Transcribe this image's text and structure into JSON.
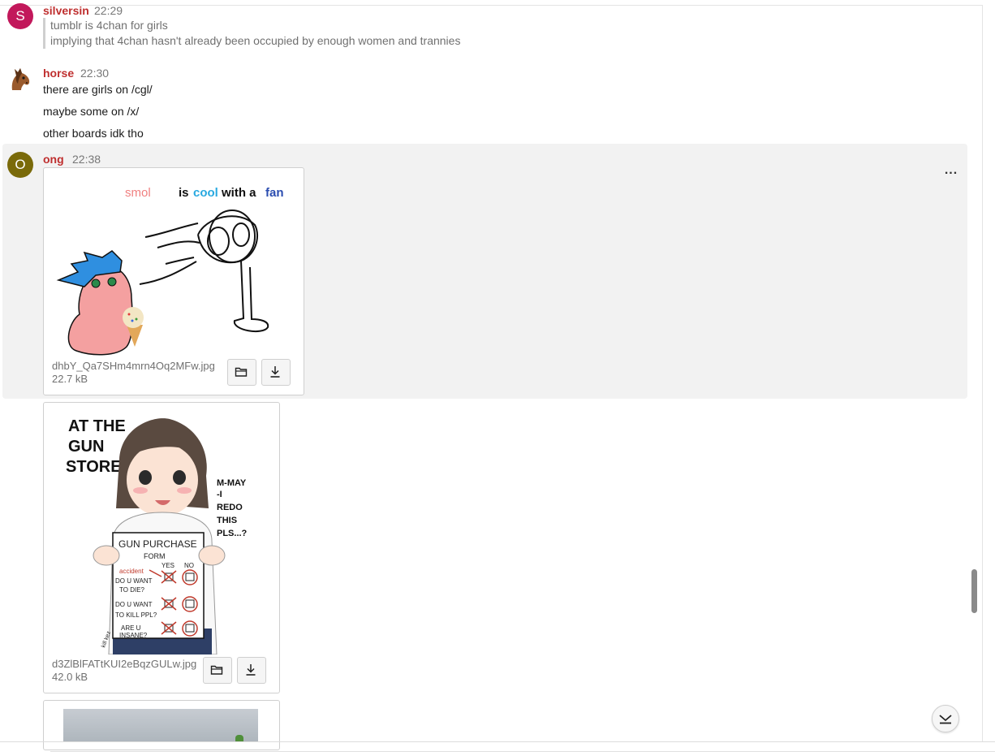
{
  "messages": [
    {
      "sender": "silversin",
      "time": "22:29",
      "avatar_letter": "S",
      "avatar_color": "#c2185b",
      "quote_lines": [
        "tumblr is 4chan for girls",
        "implying that 4chan hasn't already been occupied by enough women and trannies"
      ]
    },
    {
      "sender": "horse",
      "time": "22:30",
      "avatar_icon": "horse-icon",
      "lines": [
        "there are girls on /cgl/",
        "maybe some on /x/",
        "other boards idk tho"
      ]
    },
    {
      "sender": "ong",
      "time": "22:38",
      "avatar_letter": "O",
      "avatar_color": "#7a6a0a",
      "more_label": "...",
      "attachments": [
        {
          "filename": "dhbY_Qa7SHm4mrn4Oq2MFw.jpg",
          "size": "22.7 kB",
          "image_text": {
            "w1": "smol",
            "w2": "is",
            "w3": "cool",
            "w4": "with a",
            "w5": "fan"
          }
        },
        {
          "filename": "d3ZlBlFATtKUI2eBqzGULw.jpg",
          "size": "42.0 kB",
          "image_text": {
            "header": [
              "AT THE",
              "GUN",
              "STORE"
            ],
            "speech": [
              "M-MAY",
              "-I",
              "REDO",
              "THIS",
              "PLS...?"
            ],
            "form_title": "GUN PURCHASE",
            "form_sub": "FORM",
            "accident": "accident",
            "yes": "YES",
            "no": "NO",
            "q1a": "DO U WANT",
            "q1b": "TO DIE?",
            "q2a": "DO U WANT",
            "q2b": "TO KILL PPL?",
            "q3a": "ARE U",
            "q3b": "INSANE?",
            "signature": "kill kez"
          }
        },
        {}
      ]
    }
  ],
  "icons": {
    "open_folder": "folder-icon",
    "download": "download-icon",
    "jump": "jump-to-bottom-icon"
  },
  "colors": {
    "sender_name": "#bf2f2f",
    "hover_row": "#f2f2f2"
  }
}
